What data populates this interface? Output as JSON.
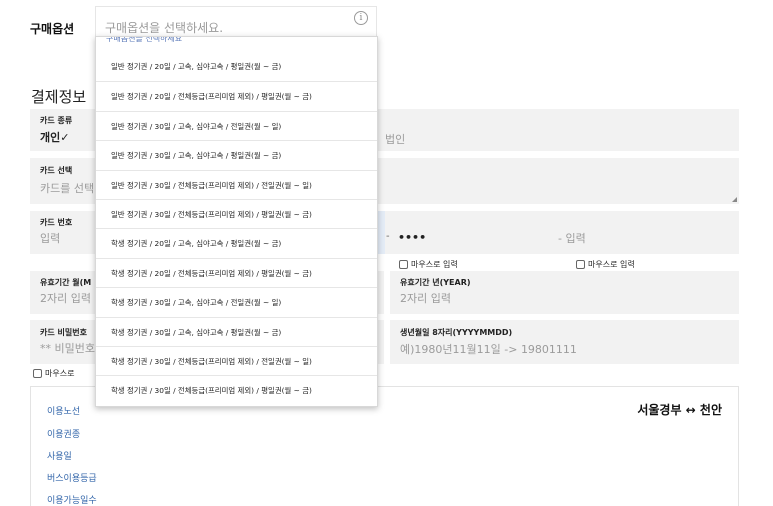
{
  "purchase_option": {
    "label": "구매옵션",
    "placeholder": "구매옵션을 선택하세요.",
    "info_icon": "i"
  },
  "dropdown": {
    "partial_top": "구매옵션을 선택하세요",
    "items": [
      "일반 정기권 / 20일 / 고속, 심야고속 / 평일권(월 ~ 금)",
      "일반 정기권 / 20일 / 전체등급(프리미엄 제외) / 평일권(월 ~ 금)",
      "일반 정기권 / 30일 / 고속, 심야고속 / 전일권(월 ~ 일)",
      "일반 정기권 / 30일 / 고속, 심야고속 / 평일권(월 ~ 금)",
      "일반 정기권 / 30일 / 전체등급(프리미엄 제외) / 전일권(월 ~ 일)",
      "일반 정기권 / 30일 / 전체등급(프리미엄 제외) / 평일권(월 ~ 금)",
      "학생 정기권 / 20일 / 고속, 심야고속 / 평일권(월 ~ 금)",
      "학생 정기권 / 20일 / 전체등급(프리미엄 제외) / 평일권(월 ~ 금)",
      "학생 정기권 / 30일 / 고속, 심야고속 / 전일권(월 ~ 일)",
      "학생 정기권 / 30일 / 고속, 심야고속 / 평일권(월 ~ 금)",
      "학생 정기권 / 30일 / 전체등급(프리미엄 제외) / 전일권(월 ~ 일)",
      "학생 정기권 / 30일 / 전체등급(프리미엄 제외) / 평일권(월 ~ 금)"
    ]
  },
  "payment": {
    "title": "결제정보",
    "card_type": {
      "label": "카드 종류",
      "personal": "개인✓",
      "corporate": "법인"
    },
    "card_select": {
      "label": "카드 선택",
      "placeholder": "카드를 선택"
    },
    "card_number": {
      "label": "카드 번호",
      "seg1": "입력",
      "dash": "-",
      "masked": "••••",
      "seg4": "- 입력"
    },
    "mouse_input_1": "마우스로 입력",
    "mouse_input_2": "마우스로 입력",
    "expiry_month": {
      "label": "유효기간 월(M",
      "placeholder": "2자리 입력"
    },
    "expiry_year": {
      "label": "유효기간 년(YEAR)",
      "placeholder": "2자리 입력"
    },
    "card_password": {
      "label": "카드 비밀번호",
      "placeholder": "** 비밀번호"
    },
    "birth": {
      "label": "생년월일 8자리(YYYYMMDD)",
      "placeholder": "예)1980년11월11일 -> 19801111"
    },
    "mouse_input_3": "마우스로"
  },
  "info": {
    "route": "서울경부 ↔ 천안",
    "links": [
      "이용노선",
      "이용권종",
      "사용일",
      "버스이용등급",
      "이용가능일수"
    ]
  }
}
